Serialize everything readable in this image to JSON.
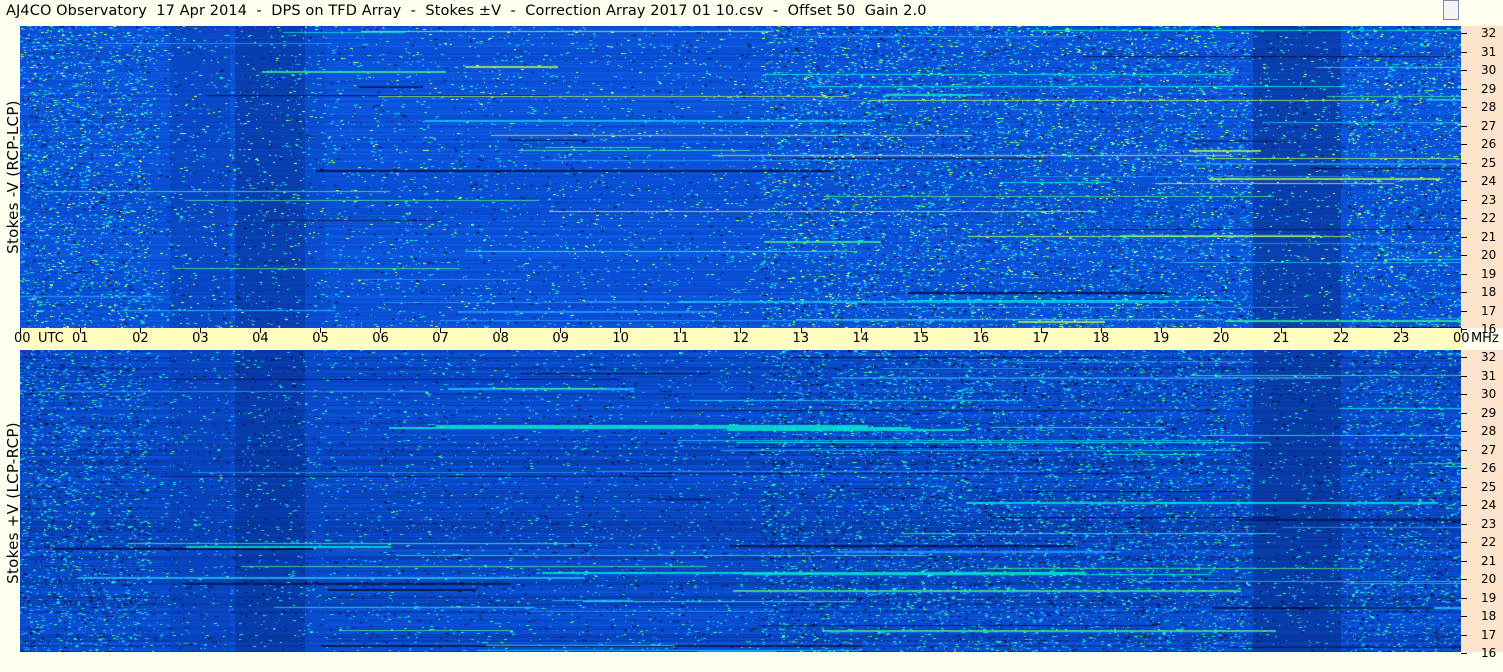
{
  "window": {
    "title": "AJ4CO Observatory  17 Apr 2014  -  DPS on TFD Array  -  Stokes ±V  -  Correction Array 2017 01 10.csv  -  Offset 50  Gain 2.0"
  },
  "panels": [
    {
      "id": "top",
      "ylabel": "Stokes -V (RCP-LCP)"
    },
    {
      "id": "bottom",
      "ylabel": "Stokes +V (LCP-RCP)"
    }
  ],
  "freq_axis": {
    "unit": "MHz",
    "ticks": [
      "32",
      "31",
      "30",
      "29",
      "28",
      "27",
      "26",
      "25",
      "24",
      "23",
      "22",
      "21",
      "20",
      "19",
      "18",
      "17",
      "16"
    ]
  },
  "time_axis": {
    "utc_label": "UTC",
    "ticks": [
      "00",
      "01",
      "02",
      "03",
      "04",
      "05",
      "06",
      "07",
      "08",
      "09",
      "10",
      "11",
      "12",
      "13",
      "14",
      "15",
      "16",
      "17",
      "18",
      "19",
      "20",
      "21",
      "22",
      "23",
      "00"
    ]
  },
  "colors": {
    "background": "#0b50d8",
    "axis_band": "#fbe3cc",
    "time_band": "#fffdc0"
  }
}
